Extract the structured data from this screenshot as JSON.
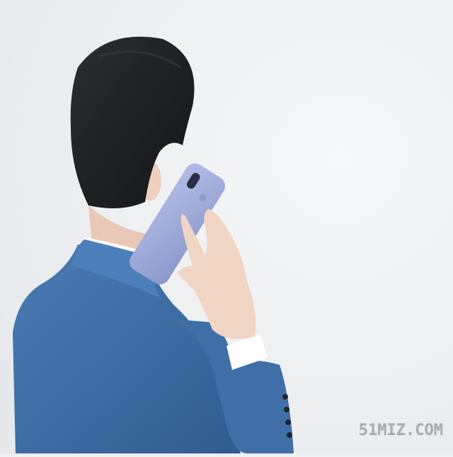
{
  "photo": {
    "subject": "man-in-blue-suit-on-phone",
    "colors": {
      "background": "#eef0f2",
      "suit": "#3f6fa6",
      "hair": "#1e1f22",
      "phone": "#9aa7d6",
      "skin": "#f0d5c4"
    }
  },
  "watermark": {
    "text": "51MIZ.COM"
  }
}
